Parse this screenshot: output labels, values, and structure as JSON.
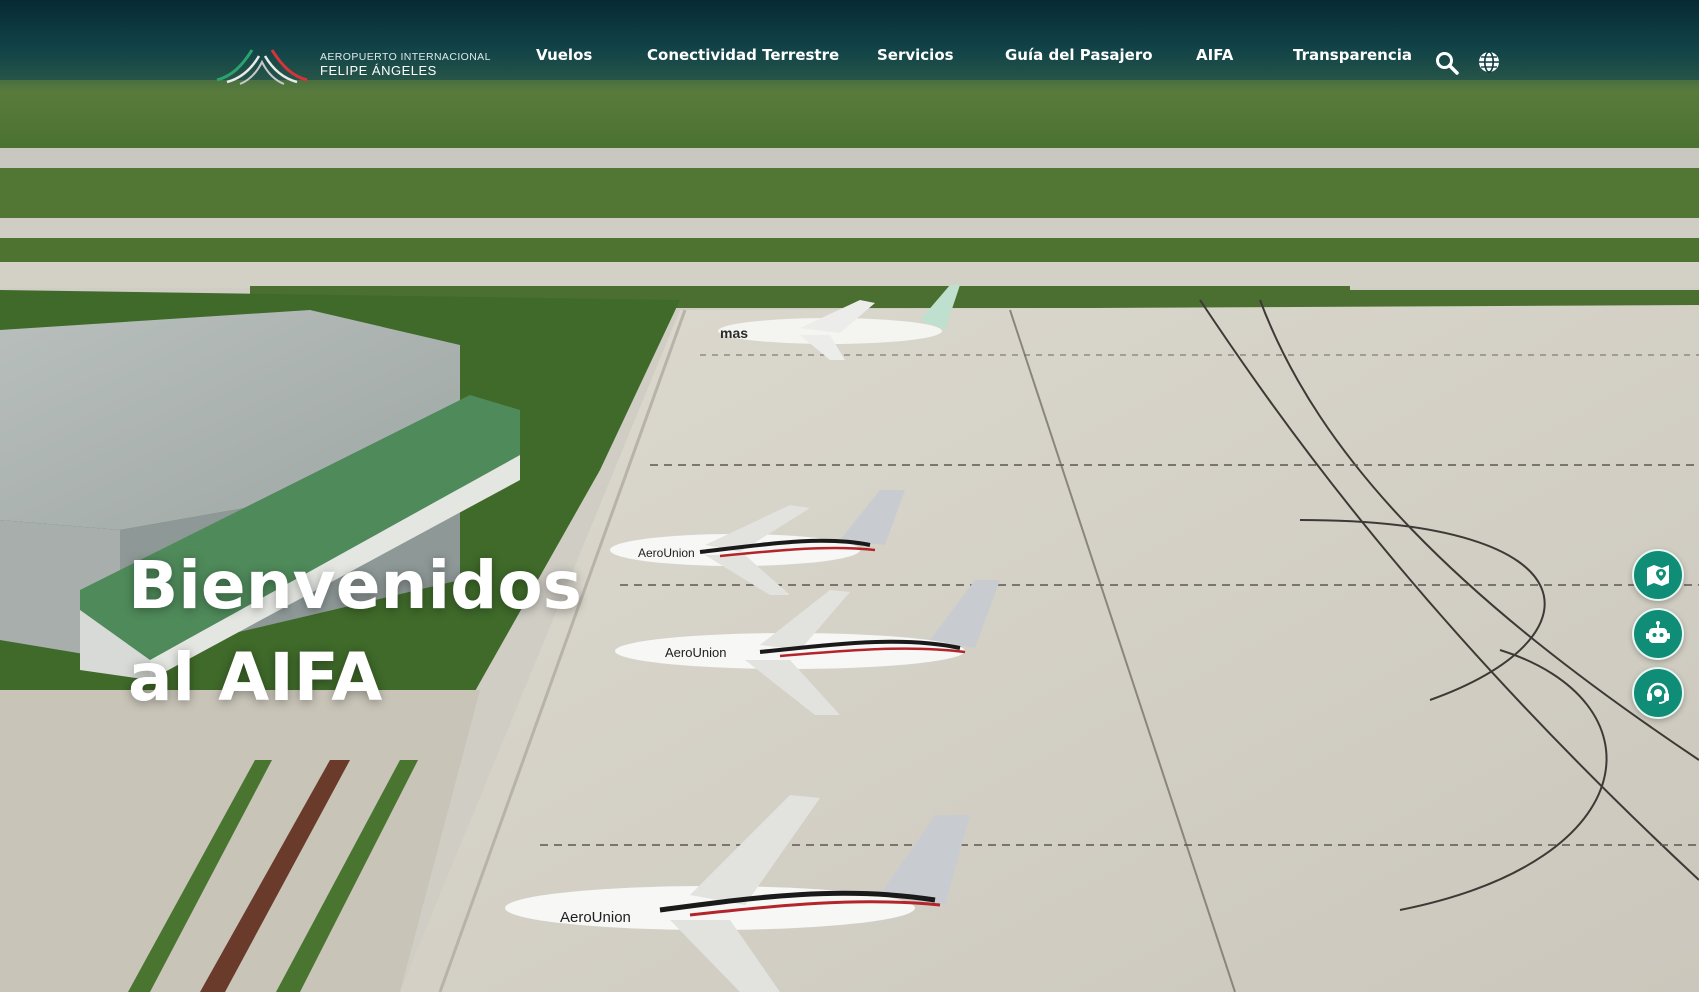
{
  "header": {
    "logo": {
      "line1": "AEROPUERTO INTERNACIONAL",
      "line2": "FELIPE ÁNGELES",
      "icon": "aifa-logo-mark"
    },
    "nav": [
      {
        "label": "Vuelos"
      },
      {
        "label": "Conectividad Terrestre"
      },
      {
        "label": "Servicios"
      },
      {
        "label": "Guía del Pasajero"
      },
      {
        "label": "AIFA"
      },
      {
        "label": "Transparencia"
      }
    ],
    "icons": {
      "search": "search-icon",
      "language": "globe-icon"
    }
  },
  "hero": {
    "headline_line1": "Bienvenidos",
    "headline_line2": "al AIFA",
    "aircraft_liveries": [
      "mas",
      "AeroUnion",
      "AeroUnion",
      "AeroUnion"
    ]
  },
  "floating_actions": [
    {
      "name": "map-button",
      "icon": "map-icon"
    },
    {
      "name": "chatbot-button",
      "icon": "robot-icon"
    },
    {
      "name": "support-button",
      "icon": "headset-icon"
    }
  ],
  "colors": {
    "header_bg": "#052834",
    "accent_green": "#0f8d76",
    "apron": "#d8d5cb",
    "grass": "#4f7a34",
    "text_white": "#ffffff"
  }
}
